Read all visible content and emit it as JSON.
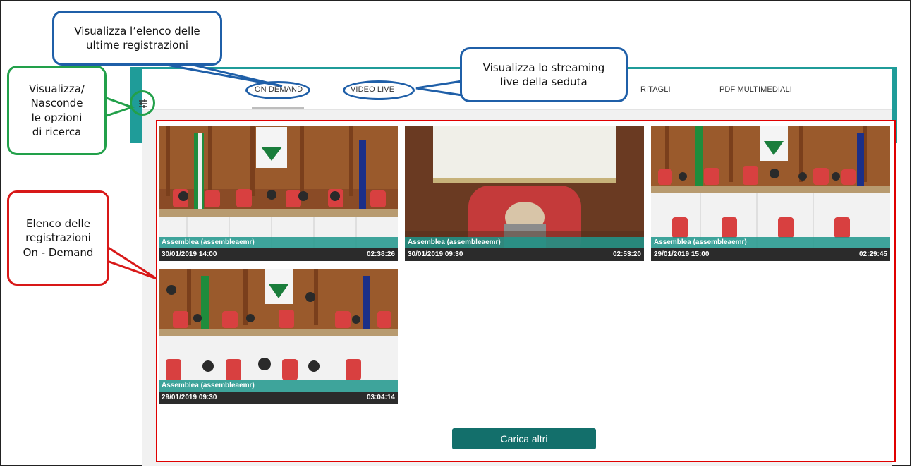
{
  "tabs": [
    {
      "label": "ON DEMAND",
      "active": true
    },
    {
      "label": "VIDEO LIVE",
      "active": false
    },
    {
      "label": "RITAGLI",
      "active": false
    },
    {
      "label": "PDF MULTIMEDIALI",
      "active": false
    }
  ],
  "recordings": [
    {
      "title": "Assemblea (assembleaemr)",
      "date": "30/01/2019 14:00",
      "duration": "02:38:26"
    },
    {
      "title": "Assemblea (assembleaemr)",
      "date": "30/01/2019 09:30",
      "duration": "02:53:20"
    },
    {
      "title": "Assemblea (assembleaemr)",
      "date": "29/01/2019 15:00",
      "duration": "02:29:45"
    },
    {
      "title": "Assemblea (assembleaemr)",
      "date": "29/01/2019 09:30",
      "duration": "03:04:14"
    }
  ],
  "load_more_label": "Carica altri",
  "callouts": {
    "latest": "Visualizza l’elenco delle\nultime registrazioni",
    "live": "Visualizza lo streaming\nlive della seduta",
    "toggle": "Visualizza/\nNasconde\nle opzioni\ndi ricerca",
    "list": "Elenco delle\nregistrazioni\nOn - Demand"
  },
  "colors": {
    "accent": "#1f9c99",
    "button": "#136f6b",
    "callout_blue": "#1f5fa8",
    "callout_green": "#22a04a",
    "callout_red": "#d81818"
  }
}
